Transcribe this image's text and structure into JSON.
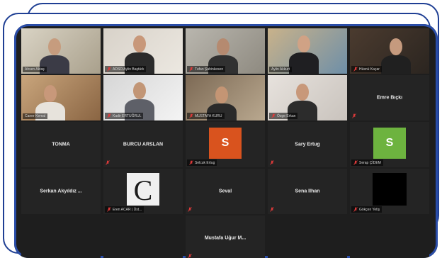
{
  "colors": {
    "frame": "#1f3f94",
    "background": "#1e1e1e",
    "tile": "#242424",
    "active_border": "#c8d84a",
    "mic_muted": "#e03a3a",
    "avatar_orange": "#d9531e",
    "avatar_green": "#6db33f"
  },
  "participants": [
    {
      "name": "Ahsen Aktaş",
      "label": "Ahsen Aktaş",
      "type": "video",
      "muted": false
    },
    {
      "name": "ADSO Aylin Baştürk",
      "label": "ADSO Aylin Baştürk",
      "type": "video",
      "muted": true
    },
    {
      "name": "Tufan Şahinkesen",
      "label": "Tufan Şahinkesen",
      "type": "video",
      "muted": true
    },
    {
      "name": "Aylin Akkurt",
      "label": "Aylin Akkurt",
      "type": "video",
      "muted": false,
      "active": true
    },
    {
      "name": "Hüsnü Kaçar",
      "label": "Hüsnü Kaçar",
      "type": "video",
      "muted": true
    },
    {
      "name": "Caner Kemal",
      "label": "Caner Kemal",
      "type": "video",
      "muted": false
    },
    {
      "name": "Kadir ERTUĞRUL",
      "label": "Kadir ERTUĞRUL",
      "type": "video",
      "muted": true
    },
    {
      "name": "Mustafa KURU",
      "label": "MUSTAFA KURU",
      "type": "video",
      "muted": true
    },
    {
      "name": "Özge Erkan",
      "label": "Özge Erkan",
      "type": "video",
      "muted": true
    },
    {
      "name": "Emre Bıçkı",
      "label": "",
      "type": "name",
      "muted": true
    },
    {
      "name": "TONMA",
      "label": "",
      "type": "name",
      "muted": false
    },
    {
      "name": "BURCU ARSLAN",
      "label": "",
      "type": "name",
      "muted": true
    },
    {
      "name": "Selcuk Ertug",
      "label": "Selcuk Ertug",
      "type": "avatar",
      "initial": "S",
      "avatar_color": "orange",
      "muted": true
    },
    {
      "name": "Sary Ertug",
      "label": "",
      "type": "name",
      "muted": true
    },
    {
      "name": "Serap ÇİDEM",
      "label": "Serap ÇİDEM",
      "type": "avatar",
      "initial": "S",
      "avatar_color": "green",
      "muted": true
    },
    {
      "name": "Serkan Akyıldız ...",
      "label": "",
      "type": "name",
      "muted": false
    },
    {
      "name": "Eren ACAR",
      "label": "Eren ACAR | Üst...",
      "type": "photo",
      "initial": "C",
      "muted": true
    },
    {
      "name": "Seval",
      "label": "",
      "type": "name",
      "muted": true
    },
    {
      "name": "Sena İlhan",
      "label": "",
      "type": "name",
      "muted": true
    },
    {
      "name": "Gökçen Yetiş",
      "label": "Gökçen Yetiş",
      "type": "black",
      "muted": true
    },
    {
      "name": "",
      "label": "",
      "type": "empty",
      "muted": false
    },
    {
      "name": "",
      "label": "",
      "type": "empty",
      "muted": false
    },
    {
      "name": "Mustafa Uğur M...",
      "label": "",
      "type": "name",
      "muted": true
    },
    {
      "name": "",
      "label": "",
      "type": "empty",
      "muted": false
    },
    {
      "name": "",
      "label": "",
      "type": "empty",
      "muted": false
    }
  ]
}
